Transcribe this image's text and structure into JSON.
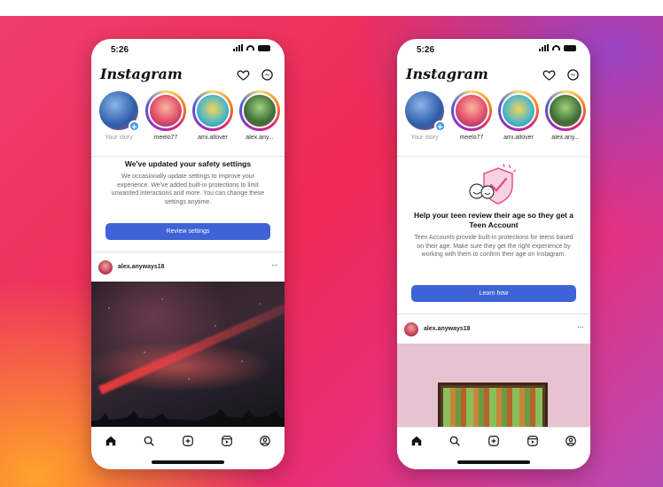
{
  "phones": {
    "left": {
      "status_time": "5:26",
      "brand": "Instagram",
      "stories": [
        {
          "name": "Your story"
        },
        {
          "name": "meelo77"
        },
        {
          "name": "ami.allover"
        },
        {
          "name": "alex.any..."
        }
      ],
      "notice": {
        "title": "We've updated your safety settings",
        "body": "We occasionally update settings to improve your experience. We've added built-in protections to limit unwanted interactions and more. You can change these settings anytime."
      },
      "cta_label": "Review settings",
      "post_user": "alex.anyways18",
      "post_more": "···"
    },
    "right": {
      "status_time": "5:26",
      "brand": "Instagram",
      "stories": [
        {
          "name": "Your story"
        },
        {
          "name": "meelo77"
        },
        {
          "name": "ami.allover"
        },
        {
          "name": "alex.any..."
        }
      ],
      "notice": {
        "title": "Help your teen review their age so they get a Teen Account",
        "body": "Teen Accounts provide built-in protections for teens based on their age. Make sure they get the right experience by working with them to confirm their age on Instagram."
      },
      "cta_label": "Learn how",
      "post_user": "alex.anyways18",
      "post_more": "···"
    }
  },
  "icons": [
    "heart-icon",
    "messenger-icon",
    "home-icon",
    "search-icon",
    "create-icon",
    "reels-icon",
    "profile-icon"
  ],
  "colors": {
    "cta": "#3d63d6",
    "story_add": "#3897f0",
    "gradient": [
      "#ffaa28",
      "#ee2a55",
      "#b64bb6"
    ]
  }
}
